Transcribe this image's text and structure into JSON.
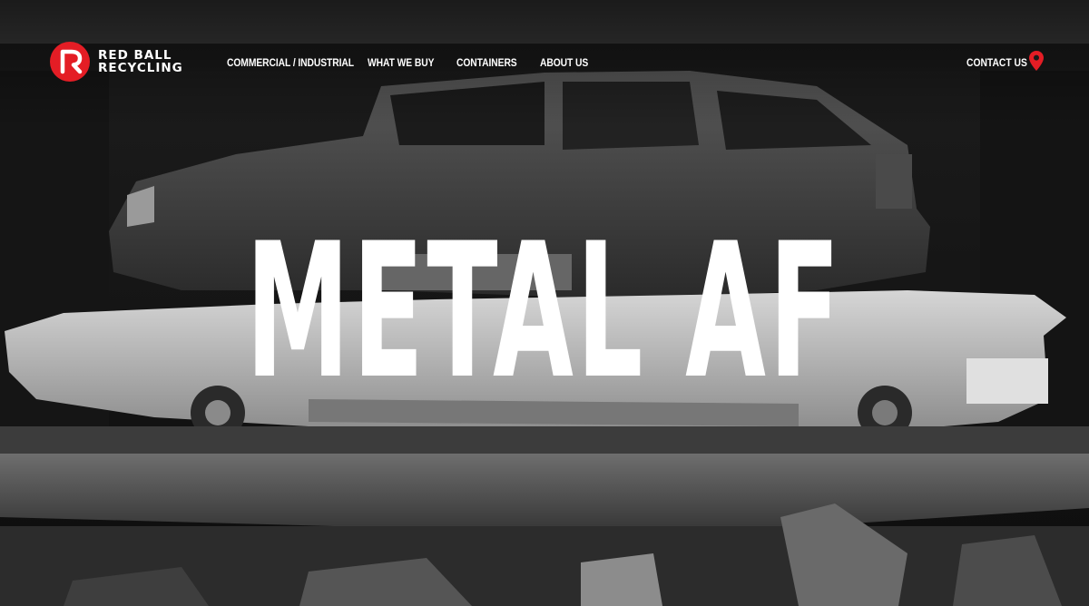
{
  "brand": {
    "name_line1": "RED BALL",
    "name_line2": "RECYCLING",
    "logo_icon": "red-ball-r-logo",
    "accent_color": "#e41d25"
  },
  "nav": {
    "items": [
      {
        "label": "COMMERCIAL / INDUSTRIAL"
      },
      {
        "label": "WHAT WE BUY"
      },
      {
        "label": "CONTAINERS"
      },
      {
        "label": "ABOUT US"
      }
    ],
    "contact_label": "CONTACT US",
    "location_icon": "map-pin-icon"
  },
  "hero": {
    "headline": "METAL AF",
    "background": "crushed-cars-grayscale-photo"
  }
}
